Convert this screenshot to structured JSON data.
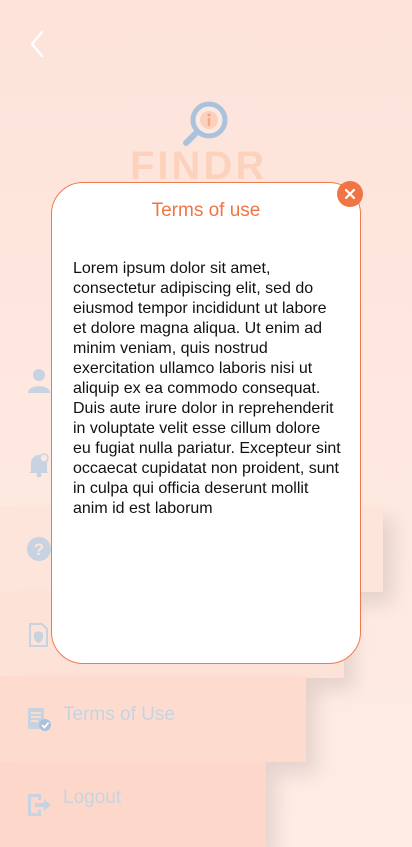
{
  "app": {
    "brand": "FINDR"
  },
  "menu": {
    "items": [
      {
        "label": "",
        "icon": "user-icon"
      },
      {
        "label": "",
        "icon": "bell-icon"
      },
      {
        "label": "",
        "icon": "help-icon"
      },
      {
        "label": "",
        "icon": "shield-document-icon"
      },
      {
        "label": "Terms of Use",
        "icon": "document-check-icon"
      },
      {
        "label": "Logout",
        "icon": "logout-icon"
      }
    ]
  },
  "dialog": {
    "title": "Terms of use",
    "body": "Lorem ipsum dolor sit amet, consectetur adipiscing elit, sed do eiusmod tempor incididunt ut labore et dolore magna aliqua. Ut enim ad minim veniam, quis nostrud exercitation ullamco laboris nisi ut aliquip ex ea commodo consequat. Duis aute irure dolor in reprehenderit in voluptate velit esse cillum dolore eu fugiat nulla pariatur. Excepteur sint occaecat cupidatat non proident, sunt in culpa qui officia deserunt mollit anim id est laborum"
  },
  "colors": {
    "accent": "#f07545",
    "menu_icon": "#c7d3e0"
  }
}
